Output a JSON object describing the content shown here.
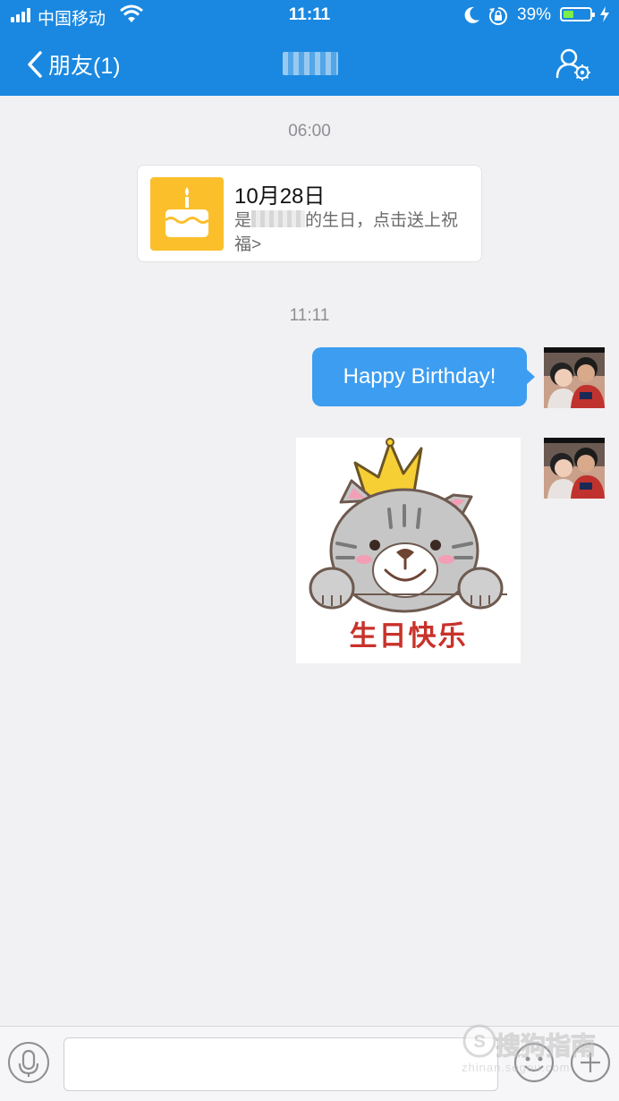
{
  "status_bar": {
    "carrier": "中国移动",
    "time": "11:11",
    "battery": "39%",
    "battery_level": 0.39
  },
  "nav": {
    "back_label": "朋友(1)",
    "title": ""
  },
  "chat": {
    "timestamp_1": "06:00",
    "birthday_card": {
      "date": "10月28日",
      "text_prefix": "是",
      "text_suffix": "的生日，点击送上祝福>"
    },
    "timestamp_2": "11:11",
    "message_text": "Happy Birthday!",
    "sticker_text": "生日快乐"
  },
  "input_bar": {
    "placeholder": ""
  },
  "watermark": {
    "main": "搜狗指南",
    "sub": "zhinan.sogou.com"
  },
  "colors": {
    "header": "#1a88e0",
    "bubble": "#3d9df0",
    "cake_tile": "#fbbf2c",
    "background": "#f1f1f3"
  }
}
